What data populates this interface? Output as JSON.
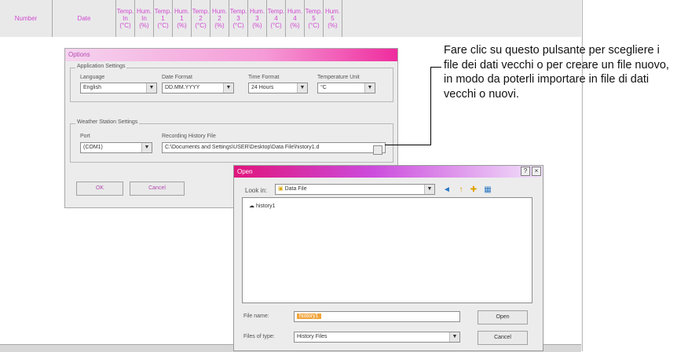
{
  "table": {
    "headers": [
      {
        "label": "Number"
      },
      {
        "label": "Date"
      },
      {
        "label": "Temp.\nIn\n(°C)"
      },
      {
        "label": "Hum.\nIn\n(%)"
      },
      {
        "label": "Temp.\n1\n(°C)"
      },
      {
        "label": "Hum.\n1\n(%)"
      },
      {
        "label": "Temp.\n2\n(°C)"
      },
      {
        "label": "Hum.\n2\n(%)"
      },
      {
        "label": "Temp.\n3\n(°C)"
      },
      {
        "label": "Hum.\n3\n(%)"
      },
      {
        "label": "Temp.\n4\n(°C)"
      },
      {
        "label": "Hum.\n4\n(%)"
      },
      {
        "label": "Temp.\n5\n(°C)"
      },
      {
        "label": "Hum.\n5\n(%)"
      }
    ]
  },
  "options_dialog": {
    "title": "Options",
    "application_settings": {
      "group_label": "Application Settings",
      "language_label": "Language",
      "language_value": "English",
      "date_format_label": "Date Format",
      "date_format_value": "DD.MM.YYYY",
      "time_format_label": "Time Format",
      "time_format_value": "24 Hours",
      "temperature_unit_label": "Temperature Unit",
      "temperature_unit_value": "°C"
    },
    "weather_station_settings": {
      "group_label": "Weather Station Settings",
      "port_label": "Port",
      "port_value": "(COM1)",
      "history_file_label": "Recording History File",
      "history_file_value": "C:\\Documents and Settings\\USER\\Desktop\\Data File\\history1.d"
    },
    "ok_label": "OK",
    "cancel_label": "Cancel"
  },
  "open_dialog": {
    "title": "Open",
    "help_symbol": "?",
    "close_symbol": "×",
    "look_in_label": "Look in:",
    "look_in_value": "Data File",
    "files": [
      "history1"
    ],
    "file_name_label": "File name:",
    "file_name_value": "history1",
    "files_of_type_label": "Files of type:",
    "files_of_type_value": "History Files",
    "open_label": "Open",
    "cancel_label": "Cancel",
    "toolbar_icons": [
      "back-icon",
      "up-folder-icon",
      "new-folder-icon",
      "view-menu-icon"
    ]
  },
  "annotation": {
    "text": "Fare clic su questo pulsante per scegliere i file dei dati vecchi o per creare un file nuovo, in modo da poterli importare in file di dati vecchi o nuovi."
  },
  "colors": {
    "header_text": "#d14ad0",
    "options_title_gradient_end": "#ef2c9e",
    "open_title_gradient_start": "#e0157d",
    "selection_highlight": "#f0a53c"
  }
}
